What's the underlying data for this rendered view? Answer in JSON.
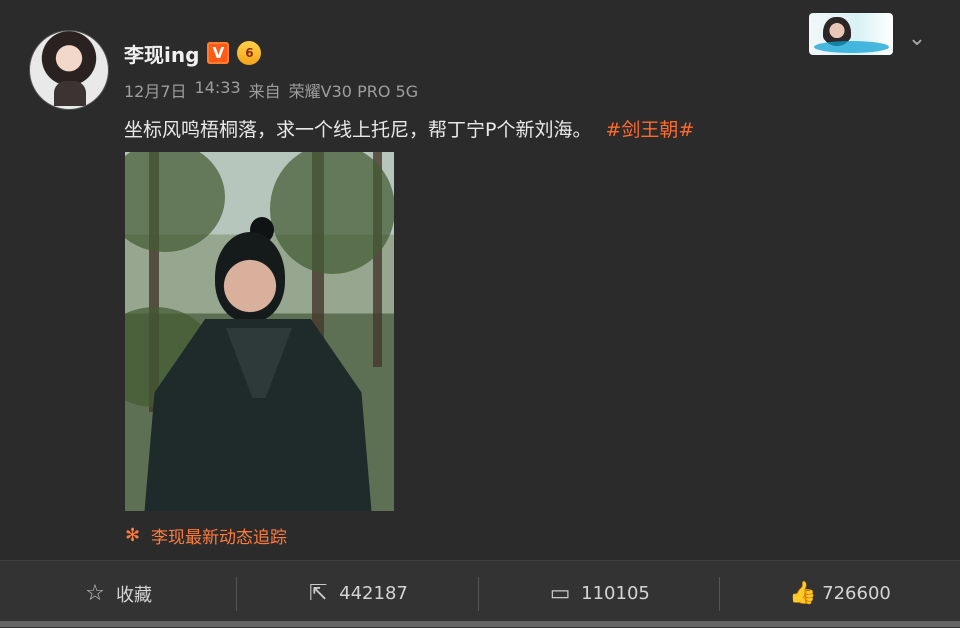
{
  "post": {
    "username": "李现ing",
    "vip_badge": "V",
    "level_badge": "6",
    "date": "12月7日",
    "time": "14:33",
    "source_label": "来自",
    "device": "荣耀V30 PRO 5G",
    "text": "坐标风鸣梧桐落，求一个线上托尼，帮丁宁P个新刘海。",
    "hashtag": "#剑王朝#",
    "tracking_label": "李现最新动态追踪"
  },
  "actions": {
    "favorite": "收藏",
    "share_count": "442187",
    "comment_count": "110105",
    "like_count": "726600"
  },
  "icons": {
    "star": "star-icon",
    "share": "share-icon",
    "comment": "comment-icon",
    "like": "like-icon",
    "chevron": "chevron-down-icon",
    "flower": "flower-icon"
  },
  "colors": {
    "background": "#2b2b2b",
    "footer": "#333333",
    "accent": "#ff6a2d",
    "vip": "#ff5a16"
  }
}
